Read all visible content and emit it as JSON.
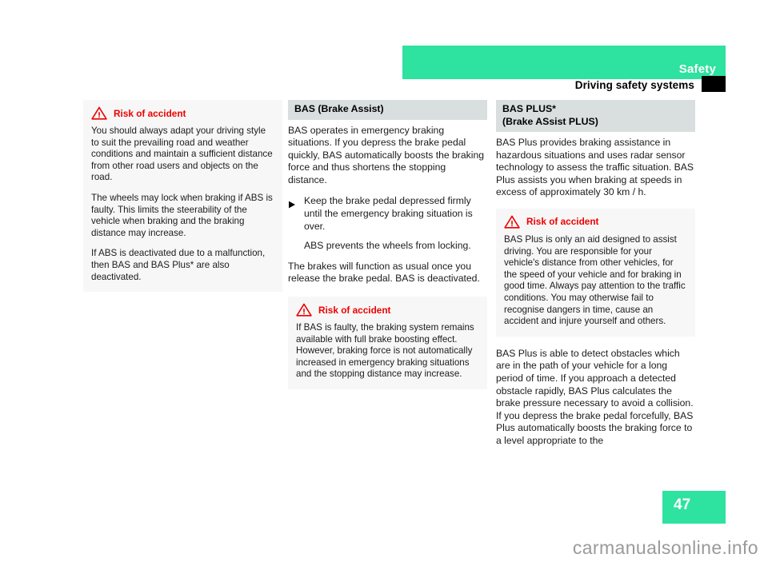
{
  "header": {
    "title": "Safety",
    "subtitle": "Driving safety systems",
    "band_color": "#2EE2A0",
    "marker_color": "#000000"
  },
  "warning_label": "Risk of accident",
  "warning_icon": "warning-triangle-icon",
  "warning_color": "#EE0000",
  "step_marker_icon": "triangle-right-bullet-icon",
  "columns": {
    "col1": {
      "warning": {
        "title": "Risk of accident",
        "paragraphs": [
          "You should always adapt your driving style to suit the prevailing road and weather conditions and maintain a sufficient distance from other road users and objects on the road.",
          "The wheels may lock when braking if ABS is faulty. This limits the steerability of the vehicle when braking and the braking distance may increase.",
          "If ABS is deactivated due to a malfunction, then BAS and BAS Plus* are also deactivated."
        ]
      }
    },
    "col2": {
      "heading": "BAS (Brake Assist)",
      "intro": "BAS operates in emergency braking situations. If you depress the brake pedal quickly, BAS automatically boosts the braking force and thus shortens the stopping distance.",
      "step": "Keep the brake pedal depressed firmly until the emergency braking situation is over.",
      "step_note": "ABS prevents the wheels from locking.",
      "outro": "The brakes will function as usual once you release the brake pedal. BAS is deactivated.",
      "warning": {
        "title": "Risk of accident",
        "text": "If BAS is faulty, the braking system remains available with full brake boosting effect. However, braking force is not automatically increased in emergency braking situations and the stopping distance may increase."
      }
    },
    "col3": {
      "heading_line1": "BAS PLUS*",
      "heading_line2": "(Brake ASsist PLUS)",
      "intro": "BAS Plus provides braking assistance in hazardous situations and uses radar sensor technology to assess the traffic situation. BAS Plus assists you when braking at speeds in excess of approximately 30 km / h.",
      "warning": {
        "title": "Risk of accident",
        "text": "BAS Plus is only an aid designed to assist driving. You are responsible for your vehicle's distance from other vehicles, for the speed of your vehicle and for braking in good time. Always pay attention to the traffic conditions. You may otherwise fail to recognise dangers in time, cause an accident and injure yourself and others."
      },
      "outro": "BAS Plus is able to detect obstacles which are in the path of your vehicle for a long period of time. If you approach a detected obstacle rapidly, BAS Plus calculates the brake pressure necessary to avoid a collision. If you depress the brake pedal forcefully, BAS Plus automatically boosts the braking force to a level appropriate to the"
    }
  },
  "footer": {
    "page_number": "47",
    "page_box_color": "#2EE2A0",
    "watermark": "carmanualsonline.info"
  }
}
